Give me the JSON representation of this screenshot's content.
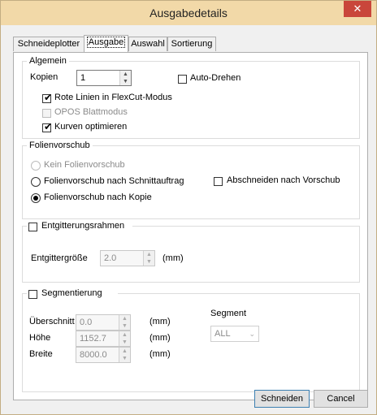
{
  "window": {
    "title": "Ausgabedetails",
    "close_glyph": "✕"
  },
  "tabs": [
    {
      "label": "Schneideplotter"
    },
    {
      "label": "Ausgabe"
    },
    {
      "label": "Auswahl"
    },
    {
      "label": "Sortierung"
    }
  ],
  "algemein": {
    "legend": "Algemein",
    "copies_label": "Kopien",
    "copies_value": "1",
    "auto_rotate_label": "Auto-Drehen",
    "auto_rotate_checked": false,
    "red_lines_label": "Rote Linien in FlexCut-Modus",
    "red_lines_checked": true,
    "opos_label": "OPOS Blattmodus",
    "opos_checked": false,
    "optimize_curves_label": "Kurven optimieren",
    "optimize_curves_checked": true
  },
  "feed": {
    "legend": "Folienvorschub",
    "options": [
      {
        "label": "Kein Folienvorschub",
        "selected": false,
        "enabled": false
      },
      {
        "label": "Folienvorschub nach Schnittauftrag",
        "selected": false,
        "enabled": true
      },
      {
        "label": "Folienvorschub nach Kopie",
        "selected": true,
        "enabled": true
      }
    ],
    "cut_after_feed_label": "Abschneiden nach Vorschub",
    "cut_after_feed_checked": false
  },
  "weeding": {
    "checkbox_label": "Entgitterungsrahmen",
    "checked": false,
    "size_label": "Entgittergröße",
    "size_value": "2.0",
    "size_unit": "(mm)"
  },
  "segmentation": {
    "checkbox_label": "Segmentierung",
    "checked": false,
    "overlap_label": "Überschnitt",
    "overlap_value": "0.0",
    "height_label": "Höhe",
    "height_value": "1152.7",
    "width_label": "Breite",
    "width_value": "8000.0",
    "unit": "(mm)",
    "segment_label": "Segment",
    "segment_value": "ALL"
  },
  "buttons": {
    "cut": "Schneiden",
    "cancel": "Cancel"
  },
  "colors": {
    "titlebar": "#f2d9a8",
    "close": "#c9463b",
    "accent": "#3c7fb1"
  },
  "icons": {
    "check": "✔",
    "spin_up": "▲",
    "spin_down": "▼",
    "dropdown": "⌄"
  }
}
